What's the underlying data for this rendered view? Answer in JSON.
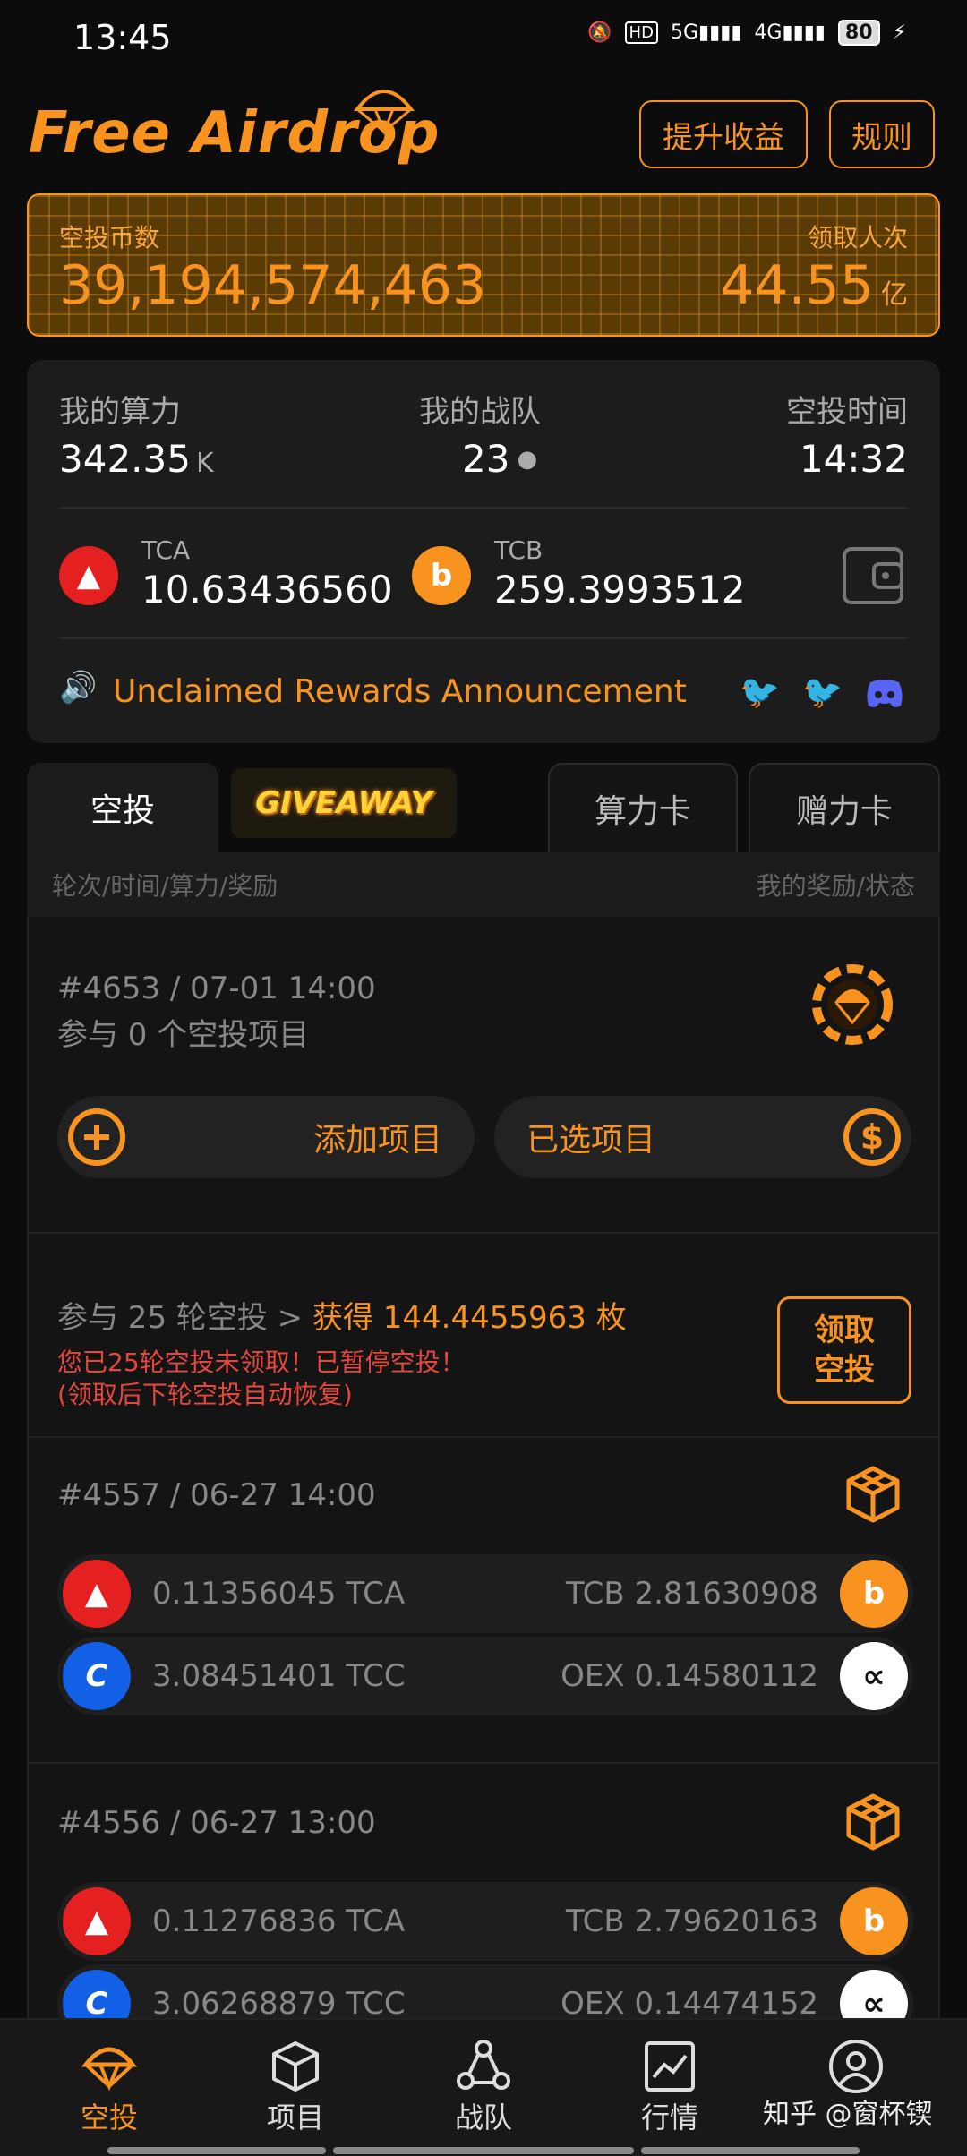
{
  "status_bar": {
    "time": "13:45",
    "network1": "5G",
    "network2": "4G",
    "battery": "80",
    "hd": "HD"
  },
  "header": {
    "logo": "Free Airdrop",
    "boost_button": "提升收益",
    "rules_button": "规则"
  },
  "banner": {
    "coins_label": "空投币数",
    "coins_value": "39,194,574,463",
    "claims_label": "领取人次",
    "claims_value": "44.55",
    "claims_unit": "亿"
  },
  "stats": {
    "hashrate_label": "我的算力",
    "hashrate_value": "342.35",
    "hashrate_unit": "K",
    "team_label": "我的战队",
    "team_value": "23",
    "time_label": "空投时间",
    "time_value": "14:32",
    "tca_name": "TCA",
    "tca_value": "10.63436560",
    "tcb_name": "TCB",
    "tcb_value": "259.3993512",
    "announcement": "Unclaimed Rewards Announcement"
  },
  "tabs": {
    "airdrop": "空投",
    "giveaway": "GIVEAWAY",
    "power_card": "算力卡",
    "gift_card": "赠力卡"
  },
  "subheader": {
    "left": "轮次/时间/算力/奖励",
    "right": "我的奖励/状态"
  },
  "current_round": {
    "title": "#4653 / 07-01 14:00",
    "participate": "参与 0 个空投项目",
    "add_project": "添加项目",
    "selected_project": "已选项目"
  },
  "claim": {
    "prefix": "参与 25 轮空投 > ",
    "reward": "获得 144.4455963 枚",
    "warning1": "您已25轮空投未领取！已暂停空投！",
    "warning2": "(领取后下轮空投自动恢复)",
    "button_line1": "领取",
    "button_line2": "空投"
  },
  "rounds": [
    {
      "title": "#4557 / 06-27 14:00",
      "r1_left": "0.11356045 TCA",
      "r1_right": "TCB 2.81630908",
      "r2_left": "3.08451401 TCC",
      "r2_right": "OEX 0.14580112"
    },
    {
      "title": "#4556 / 06-27 13:00",
      "r1_left": "0.11276836 TCA",
      "r1_right": "TCB 2.79620163",
      "r2_left": "3.06268879 TCC",
      "r2_right": "OEX 0.14474152"
    }
  ],
  "nav": {
    "airdrop": "空投",
    "project": "项目",
    "team": "战队",
    "market": "行情",
    "mine": "我的"
  },
  "watermark": "知乎 @窗杯锲",
  "colors": {
    "accent": "#f7931e",
    "background": "#0c0c0c",
    "card": "#1c1c1c"
  }
}
